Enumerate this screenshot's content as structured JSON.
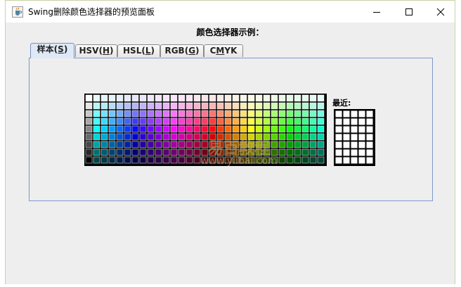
{
  "window": {
    "title": "Swing删除颜色选择器的预览面板"
  },
  "heading": "颜色选择器示例：",
  "tabs": [
    {
      "pre": "样本(",
      "key": "S",
      "post": ")",
      "selected": true
    },
    {
      "pre": "HSV(",
      "key": "H",
      "post": ")",
      "selected": false
    },
    {
      "pre": "HSL(",
      "key": "L",
      "post": ")",
      "selected": false
    },
    {
      "pre": "RGB(",
      "key": "G",
      "post": ")",
      "selected": false
    },
    {
      "pre": "C",
      "key": "M",
      "post": "YK",
      "selected": false
    }
  ],
  "swatches": {
    "columns": 31,
    "rows": 9
  },
  "recent": {
    "label": "最近:",
    "columns": 5,
    "rows": 7,
    "color": "#ffffff"
  },
  "watermark": {
    "line1": "易百教程",
    "line2": "www.yiibai.com"
  }
}
